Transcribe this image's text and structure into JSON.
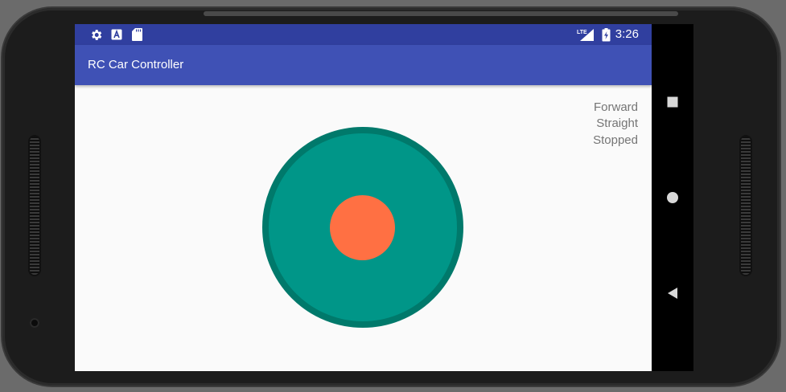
{
  "status_bar": {
    "time": "3:26",
    "icons": [
      "settings-gear-icon",
      "font-a-icon",
      "sd-card-icon",
      "lte-signal-icon",
      "battery-charging-icon"
    ],
    "lte_label": "LTE"
  },
  "app_bar": {
    "title": "RC Car Controller"
  },
  "car_status": {
    "direction": "Forward",
    "steering": "Straight",
    "motion": "Stopped"
  },
  "joystick": {
    "base_color": "#009688",
    "base_border_color": "#00796b",
    "knob_color": "#ff7043"
  },
  "navigation": {
    "buttons": [
      "recents-square-icon",
      "home-circle-icon",
      "back-triangle-icon"
    ]
  },
  "colors": {
    "status_bar": "#303f9f",
    "app_bar": "#3f51b5",
    "background": "#fafafa",
    "status_text": "#757575"
  }
}
